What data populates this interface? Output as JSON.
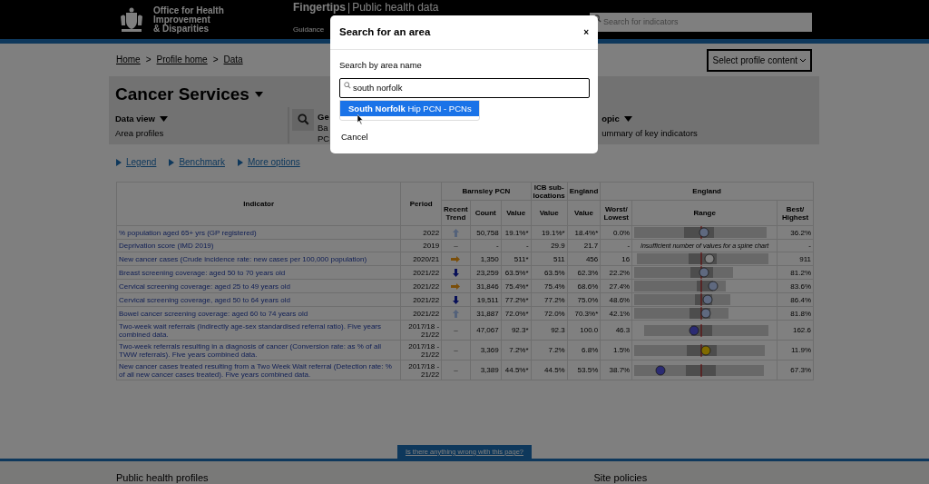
{
  "header": {
    "org_lines": [
      "Office for Health",
      "Improvement",
      "& Disparities"
    ],
    "site_title": "Fingertips",
    "site_separator": "|",
    "site_subtitle": "Public health data",
    "nav_link": "Guidance",
    "search": {
      "placeholder": "Search for indicators"
    }
  },
  "breadcrumb": [
    {
      "kind": "link",
      "text": "Home"
    },
    {
      "kind": "separator",
      "text": ">"
    },
    {
      "kind": "link",
      "text": "Profile home"
    },
    {
      "kind": "separator",
      "text": ">"
    },
    {
      "kind": "link",
      "text": "Data"
    }
  ],
  "profile_menu": {
    "label": "Select profile content"
  },
  "profile": {
    "title": "Cancer Services",
    "data_view": {
      "label": "Data view",
      "value": "Area profiles"
    },
    "area_lines": [
      "Ge",
      "Ba",
      "PC"
    ],
    "topic": {
      "label": "opic",
      "value": "ummary of key indicators"
    }
  },
  "options": [
    "Legend",
    "Benchmark",
    "More options"
  ],
  "table": {
    "group_headers": [
      "Barnsley PCN",
      "ICB sub-locations",
      "England",
      "England"
    ],
    "columns": [
      "Indicator",
      "Period",
      "Recent Trend",
      "Count",
      "Value",
      "Value",
      "Value",
      "Worst/ Lowest",
      "Range",
      "Best/ Highest"
    ],
    "rows": [
      {
        "indicator": "% population aged 65+ yrs (GP registered)",
        "period": "2022",
        "trend": {
          "kind": "up"
        },
        "count": "50,758",
        "value": "19.1%*",
        "icb": "19.1%*",
        "england": "18.4%*",
        "worst": "0.0%",
        "best": "36.2%",
        "color": "#5f697f"
      },
      {
        "indicator": "Deprivation score (IMD 2019)",
        "period": "2019",
        "trend": {
          "kind": "dash",
          "text": "–"
        },
        "count": "-",
        "value": "-",
        "icb": "29.9",
        "england": "21.7",
        "worst": "-",
        "note": "Insufficient number of values for a spine chart",
        "best": "-"
      },
      {
        "indicator": "New cancer cases (Crude incidence rate: new cases per 100,000 population)",
        "period": "2020/21",
        "trend": {
          "kind": "right"
        },
        "count": "1,350",
        "value": "511*",
        "icb": "511",
        "england": "456",
        "worst": "16",
        "best": "911",
        "color": "#808080"
      },
      {
        "indicator": "Breast screening coverage: aged 50 to 70 years old",
        "period": "2021/22",
        "trend": {
          "kind": "down"
        },
        "count": "23,259",
        "value": "63.5%*",
        "icb": "63.5%",
        "england": "62.3%",
        "worst": "22.2%",
        "best": "81.2%",
        "color": "#5f697f"
      },
      {
        "indicator": "Cervical screening coverage: aged 25 to 49 years old",
        "period": "2021/22",
        "trend": {
          "kind": "right"
        },
        "count": "31,846",
        "value": "75.4%*",
        "icb": "75.4%",
        "england": "68.6%",
        "worst": "27.4%",
        "best": "83.6%",
        "color": "#5f697f"
      },
      {
        "indicator": "Cervical screening coverage, aged 50 to 64 years old",
        "period": "2021/22",
        "trend": {
          "kind": "down"
        },
        "count": "19,511",
        "value": "77.2%*",
        "icb": "77.2%",
        "england": "75.0%",
        "worst": "48.6%",
        "best": "86.4%",
        "color": "#5f697f"
      },
      {
        "indicator": "Bowel cancer screening coverage: aged 60 to 74 years old",
        "period": "2021/22",
        "trend": {
          "kind": "up"
        },
        "count": "31,887",
        "value": "72.0%*",
        "icb": "72.0%",
        "england": "70.3%*",
        "worst": "42.1%",
        "best": "81.8%",
        "color": "#5f697f"
      },
      {
        "indicator": "Two-week wait referrals (Indirectly age-sex standardised referral ratio). Five years combined data.",
        "period": "2017/18 - 21/22",
        "trend": {
          "kind": "dash",
          "text": "–"
        },
        "count": "47,067",
        "value": "92.3*",
        "icb": "92.3",
        "england": "100.0",
        "worst": "46.3",
        "best": "162.6",
        "color": "#2b2b73"
      },
      {
        "indicator": "Two-week referrals resulting in a diagnosis of cancer (Conversion rate: as % of all TWW referrals). Five years combined data.",
        "period": "2017/18 - 21/22",
        "trend": {
          "kind": "dash",
          "text": "–"
        },
        "count": "3,369",
        "value": "7.2%*",
        "icb": "7.2%",
        "england": "6.8%",
        "worst": "1.5%",
        "best": "11.9%",
        "color": "#806a00"
      },
      {
        "indicator": "New cancer cases treated resulting from a Two Week Wait referral (Detection rate: % of all new cancer cases treated). Five years combined data.",
        "period": "2017/18 - 21/22",
        "trend": {
          "kind": "dash",
          "text": "–"
        },
        "count": "3,389",
        "value": "44.5%*",
        "icb": "44.5%",
        "england": "53.5%",
        "worst": "38.7%",
        "best": "67.3%",
        "color": "#2b2b73"
      }
    ]
  },
  "feedback_link": "Is there anything wrong with this page?",
  "footer": [
    "Public health profiles",
    "Site policies"
  ],
  "modal": {
    "title": "Search for an area",
    "close": "×",
    "label": "Search by area name",
    "value": "south norfolk",
    "suggestions": [
      {
        "text": "**South Norfolk** Hip PCN - PCNs",
        "selected": true
      }
    ],
    "cancel": "Cancel"
  }
}
